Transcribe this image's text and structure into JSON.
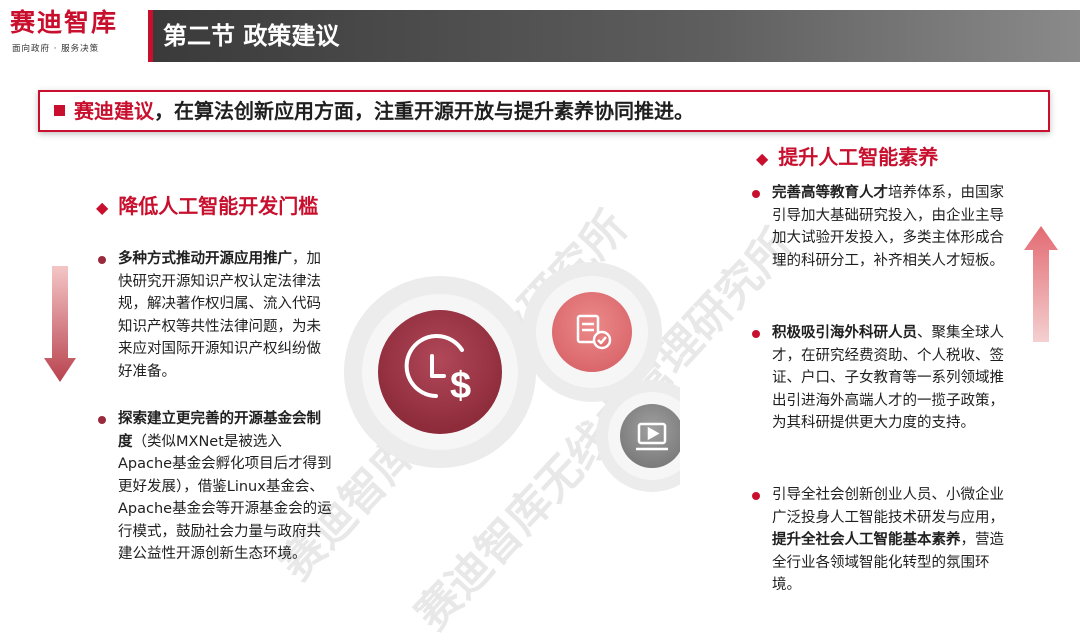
{
  "logo": {
    "name": "赛迪智库",
    "tagline": "面向政府 · 服务决策"
  },
  "header": {
    "title": "第二节 政策建议"
  },
  "banner": {
    "highlight": "赛迪建议",
    "rest": "，在算法创新应用方面，注重开源开放与提升素养协同推进。"
  },
  "left": {
    "heading": "降低人工智能开发门槛",
    "items": [
      {
        "bold": "多种方式推动开源应用推广",
        "text": "，加快研究开源知识产权认定法律法规，解决著作权归属、流入代码知识产权等共性法律问题，为未来应对国际开源知识产权纠纷做好准备。"
      },
      {
        "bold": "探索建立更完善的开源基金会制度",
        "text": "（类似MXNet是被选入Apache基金会孵化项目后才得到更好发展），借鉴Linux基金会、Apache基金会等开源基金会的运行模式，鼓励社会力量与政府共建公益性开源创新生态环境。"
      }
    ]
  },
  "right": {
    "heading": "提升人工智能素养",
    "items": [
      {
        "bold": "完善高等教育人才",
        "text": "培养体系，由国家引导加大基础研究投入，由企业主导加大试验开发投入，多类主体形成合理的科研分工，补齐相关人才短板。"
      },
      {
        "bold": "积极吸引海外科研人员",
        "text": "、聚集全球人才，在研究经费资助、个人税收、签证、户口、子女教育等一系列领域推出引进海外高端人才的一揽子政策，为其科研提供更大力度的支持。"
      },
      {
        "pre": "引导全社会创新创业人员、小微企业广泛投身人工智能技术研发与应用，",
        "bold": "提升全社会人工智能基本素养",
        "text": "，营造全行业各领域智能化转型的氛围环境。"
      }
    ]
  },
  "watermark": {
    "line1": "赛迪智库世界工业研究所",
    "line2": "赛迪智库无线电管理研究所"
  },
  "icons": {
    "center_left": "clock-dollar-icon",
    "center_top": "document-check-icon",
    "center_bottom": "video-player-icon"
  },
  "colors": {
    "brand_red": "#c8102e",
    "dark_red": "#9b2a3c",
    "gray": "#8a8a8a"
  }
}
